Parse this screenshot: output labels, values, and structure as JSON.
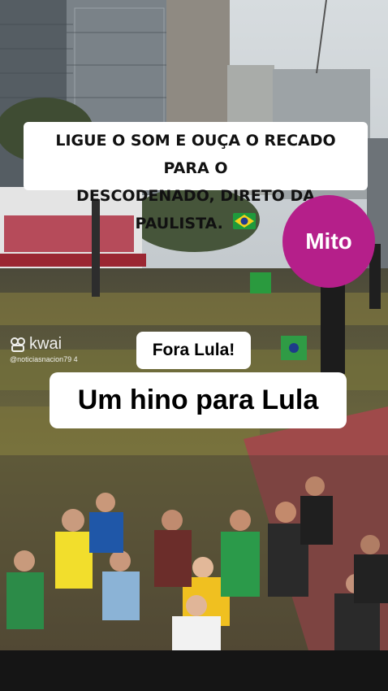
{
  "banner": {
    "line1": "LIGUE O SOM E OUÇA O RECADO PARA O",
    "line2": "DESCODENADO, DIRETO DA PAULISTA.",
    "flag_icon": "brazil-flag-icon"
  },
  "sticker": {
    "label": "Mito",
    "color": "#b51f8a"
  },
  "watermark": {
    "brand": "kwai",
    "handle": "@noticiasnacion79 4"
  },
  "caption_small": "Fora Lula!",
  "caption_large": "Um hino para Lula"
}
